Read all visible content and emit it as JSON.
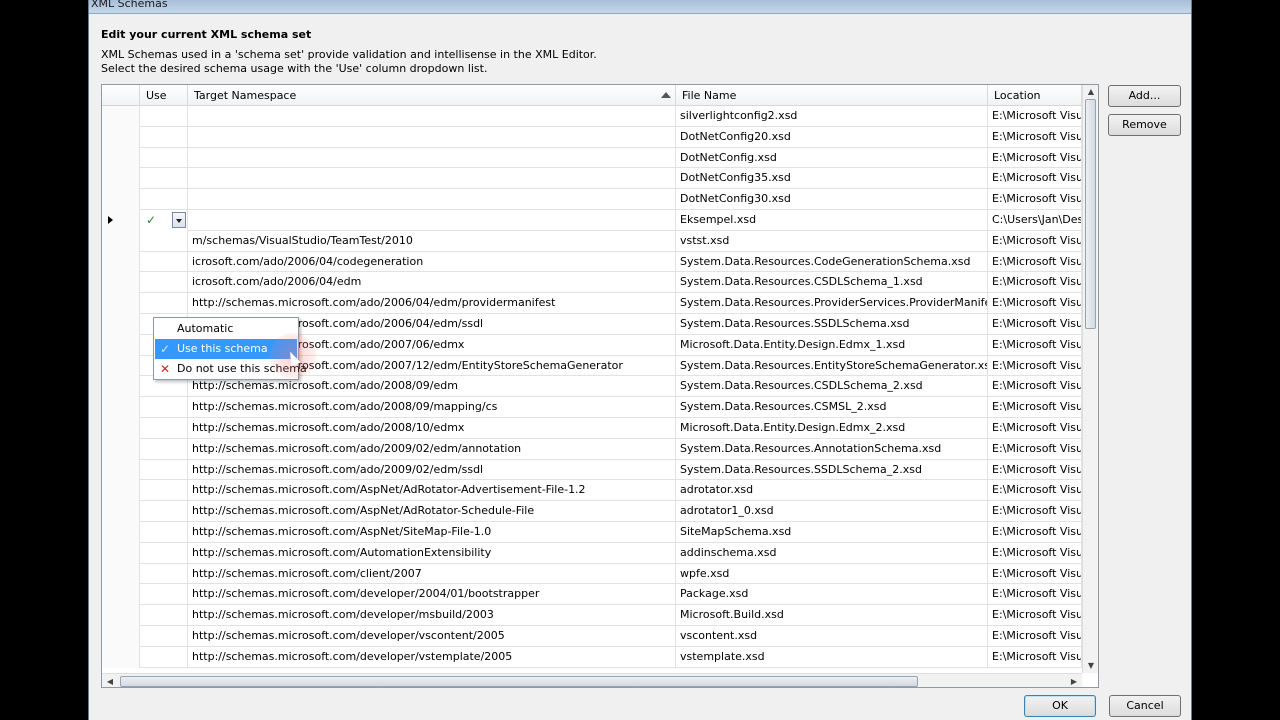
{
  "window": {
    "title": "XML Schemas"
  },
  "heading": "Edit your current XML schema set",
  "description": [
    "XML Schemas used in a 'schema set' provide validation and intellisense in the XML Editor.",
    "Select the desired schema usage with the 'Use' column dropdown list."
  ],
  "columns": {
    "use": "Use",
    "namespace": "Target Namespace",
    "file": "File Name",
    "location": "Location"
  },
  "rows": [
    {
      "ns": "",
      "file": "silverlightconfig2.xsd",
      "loc": "E:\\Microsoft Visua"
    },
    {
      "ns": "",
      "file": "DotNetConfig20.xsd",
      "loc": "E:\\Microsoft Visua"
    },
    {
      "ns": "",
      "file": "DotNetConfig.xsd",
      "loc": "E:\\Microsoft Visua"
    },
    {
      "ns": "",
      "file": "DotNetConfig35.xsd",
      "loc": "E:\\Microsoft Visua"
    },
    {
      "ns": "",
      "file": "DotNetConfig30.xsd",
      "loc": "E:\\Microsoft Visua"
    },
    {
      "ns": "",
      "file": "Eksempel.xsd",
      "loc": "C:\\Users\\Jan\\Desk"
    },
    {
      "ns": "m/schemas/VisualStudio/TeamTest/2010",
      "file": "vstst.xsd",
      "loc": "E:\\Microsoft Visua"
    },
    {
      "ns": "icrosoft.com/ado/2006/04/codegeneration",
      "file": "System.Data.Resources.CodeGenerationSchema.xsd",
      "loc": "E:\\Microsoft Visua"
    },
    {
      "ns": "icrosoft.com/ado/2006/04/edm",
      "file": "System.Data.Resources.CSDLSchema_1.xsd",
      "loc": "E:\\Microsoft Visua"
    },
    {
      "ns": "http://schemas.microsoft.com/ado/2006/04/edm/providermanifest",
      "file": "System.Data.Resources.ProviderServices.ProviderManifest.xsd",
      "loc": "E:\\Microsoft Visua"
    },
    {
      "ns": "http://schemas.microsoft.com/ado/2006/04/edm/ssdl",
      "file": "System.Data.Resources.SSDLSchema.xsd",
      "loc": "E:\\Microsoft Visua"
    },
    {
      "ns": "http://schemas.microsoft.com/ado/2007/06/edmx",
      "file": "Microsoft.Data.Entity.Design.Edmx_1.xsd",
      "loc": "E:\\Microsoft Visua"
    },
    {
      "ns": "http://schemas.microsoft.com/ado/2007/12/edm/EntityStoreSchemaGenerator",
      "file": "System.Data.Resources.EntityStoreSchemaGenerator.xsd",
      "loc": "E:\\Microsoft Visua"
    },
    {
      "ns": "http://schemas.microsoft.com/ado/2008/09/edm",
      "file": "System.Data.Resources.CSDLSchema_2.xsd",
      "loc": "E:\\Microsoft Visua"
    },
    {
      "ns": "http://schemas.microsoft.com/ado/2008/09/mapping/cs",
      "file": "System.Data.Resources.CSMSL_2.xsd",
      "loc": "E:\\Microsoft Visua"
    },
    {
      "ns": "http://schemas.microsoft.com/ado/2008/10/edmx",
      "file": "Microsoft.Data.Entity.Design.Edmx_2.xsd",
      "loc": "E:\\Microsoft Visua"
    },
    {
      "ns": "http://schemas.microsoft.com/ado/2009/02/edm/annotation",
      "file": "System.Data.Resources.AnnotationSchema.xsd",
      "loc": "E:\\Microsoft Visua"
    },
    {
      "ns": "http://schemas.microsoft.com/ado/2009/02/edm/ssdl",
      "file": "System.Data.Resources.SSDLSchema_2.xsd",
      "loc": "E:\\Microsoft Visua"
    },
    {
      "ns": "http://schemas.microsoft.com/AspNet/AdRotator-Advertisement-File-1.2",
      "file": "adrotator.xsd",
      "loc": "E:\\Microsoft Visua"
    },
    {
      "ns": "http://schemas.microsoft.com/AspNet/AdRotator-Schedule-File",
      "file": "adrotator1_0.xsd",
      "loc": "E:\\Microsoft Visua"
    },
    {
      "ns": "http://schemas.microsoft.com/AspNet/SiteMap-File-1.0",
      "file": "SiteMapSchema.xsd",
      "loc": "E:\\Microsoft Visua"
    },
    {
      "ns": "http://schemas.microsoft.com/AutomationExtensibility",
      "file": "addinschema.xsd",
      "loc": "E:\\Microsoft Visua"
    },
    {
      "ns": "http://schemas.microsoft.com/client/2007",
      "file": "wpfe.xsd",
      "loc": "E:\\Microsoft Visua"
    },
    {
      "ns": "http://schemas.microsoft.com/developer/2004/01/bootstrapper",
      "file": "Package.xsd",
      "loc": "E:\\Microsoft Visua"
    },
    {
      "ns": "http://schemas.microsoft.com/developer/msbuild/2003",
      "file": "Microsoft.Build.xsd",
      "loc": "E:\\Microsoft Visua"
    },
    {
      "ns": "http://schemas.microsoft.com/developer/vscontent/2005",
      "file": "vscontent.xsd",
      "loc": "E:\\Microsoft Visua"
    },
    {
      "ns": "http://schemas.microsoft.com/developer/vstemplate/2005",
      "file": "vstemplate.xsd",
      "loc": "E:\\Microsoft Visua"
    }
  ],
  "selected_row_use": "✓",
  "dropdown": {
    "automatic": "Automatic",
    "use": "Use this schema",
    "dont_use": "Do not use this schema"
  },
  "buttons": {
    "add": "Add...",
    "remove": "Remove",
    "ok": "OK",
    "cancel": "Cancel"
  },
  "scroll": {
    "hthumb_grip": "⦀",
    "vthumb_grip": "≡"
  }
}
